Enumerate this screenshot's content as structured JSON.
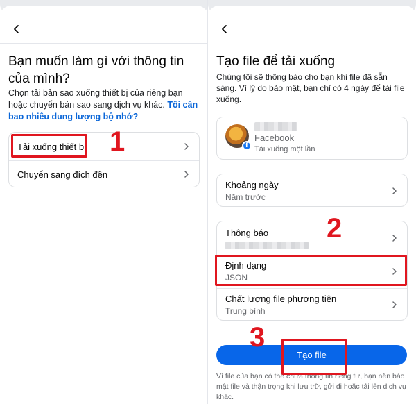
{
  "left": {
    "title": "Bạn muốn làm gì với thông tin của mình?",
    "desc_text": "Chọn tải bản sao xuống thiết bị của riêng bạn hoặc chuyển bản sao sang dịch vụ khác.",
    "desc_link": "Tôi cần bao nhiêu dung lượng bộ nhớ?",
    "options": [
      {
        "label": "Tải xuống thiết bị"
      },
      {
        "label": "Chuyển sang đích đến"
      }
    ],
    "step_number": "1"
  },
  "right": {
    "title": "Tạo file để tải xuống",
    "desc": "Chúng tôi sẽ thông báo cho bạn khi file đã sẵn sàng. Vì lý do bảo mật, bạn chỉ có 4 ngày để tải file xuống.",
    "account": {
      "platform": "Facebook",
      "subtitle": "Tải xuống một lần"
    },
    "date_range": {
      "label": "Khoảng ngày",
      "value": "Năm trước"
    },
    "notifications": {
      "label": "Thông báo"
    },
    "format": {
      "label": "Định dạng",
      "value": "JSON"
    },
    "media_quality": {
      "label": "Chất lượng file phương tiện",
      "value": "Trung bình"
    },
    "create_button": "Tạo file",
    "footer": "Vì file của bạn có thể chứa thông tin riêng tư, bạn nên bảo mật file và thận trọng khi lưu trữ, gửi đi hoặc tải lên dịch vụ khác.",
    "step2": "2",
    "step3": "3"
  },
  "colors": {
    "accent": "#0866e9",
    "highlight": "#e0161f",
    "link": "#0a66d8"
  }
}
